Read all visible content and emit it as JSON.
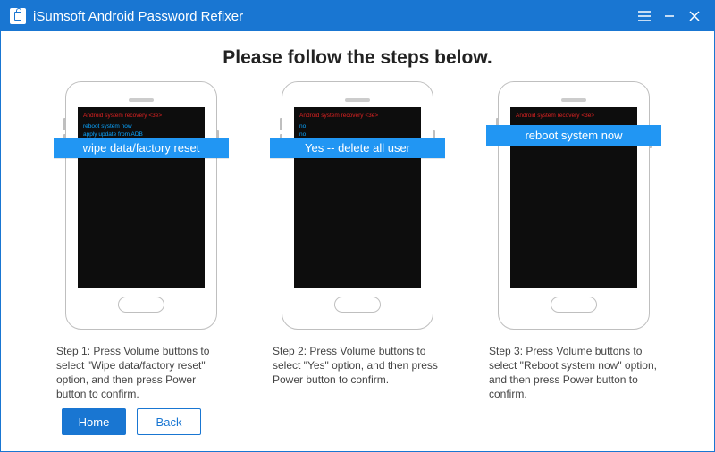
{
  "app_title": "iSumsoft Android Password Refixer",
  "heading": "Please follow the steps below.",
  "steps": [
    {
      "screen_red": "Android system recovery <3e>",
      "screen_blue": "reboot system now\napply update from ADB",
      "tag": "wipe data/factory reset",
      "caption": "Step 1: Press Volume buttons to select \"Wipe data/factory reset\" option, and then press Power button to confirm."
    },
    {
      "screen_red": "Android system recovery <3e>",
      "screen_blue": "no\nno\nno\nyes",
      "tag": "Yes -- delete all user",
      "caption": "Step 2: Press Volume buttons to select \"Yes\" option, and then press Power button to confirm."
    },
    {
      "screen_red": "Android system recovery <3e>",
      "screen_blue": " ",
      "tag": "reboot system now",
      "caption": "Step 3: Press Volume buttons to select \"Reboot system now\" option, and then press Power button to confirm."
    }
  ],
  "footer": {
    "home": "Home",
    "back": "Back"
  }
}
